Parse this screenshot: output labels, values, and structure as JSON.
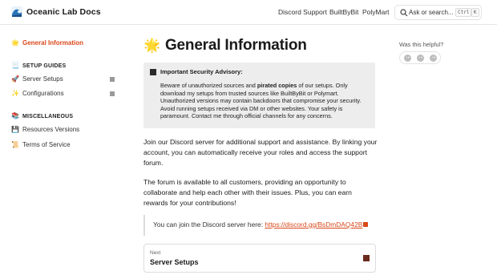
{
  "header": {
    "site_title": "Oceanic Lab Docs",
    "logo_icon": "wave-icon",
    "nav": [
      "Discord Support",
      "BuiltByBit",
      "PolyMart"
    ],
    "search_placeholder": "Ask or search...",
    "search_shortcut": [
      "Ctrl",
      "K"
    ]
  },
  "sidebar": {
    "active_item": {
      "emoji": "🌟",
      "label": "General Information"
    },
    "sections": [
      {
        "heading": {
          "emoji": "📃",
          "label": "SETUP GUIDES"
        },
        "items": [
          {
            "emoji": "🚀",
            "label": "Server Setups"
          },
          {
            "emoji": "✨",
            "label": "Configurations"
          }
        ]
      },
      {
        "heading": {
          "emoji": "📚",
          "label": "MISCELLANEOUS"
        },
        "items": [
          {
            "emoji": "💾",
            "label": "Resources Versions"
          },
          {
            "emoji": "📜",
            "label": "Terms of Service"
          }
        ]
      }
    ]
  },
  "main": {
    "title_emoji": "🌟",
    "title": "General Information",
    "advisory": {
      "title": "Important Security Advisory:",
      "body_pre": "Beware of unauthorized sources and ",
      "body_bold": "pirated copies",
      "body_post": " of our setups. Only download my setups from trusted sources like BuiltByBit or Polymart. Unauthorized versions may contain backdoors that compromise your security. Avoid running setups received via DM or other websites. Your safety is paramount. Contact me through official channels for any concerns."
    },
    "paragraph1": "Join our Discord server for additional support and assistance. By linking your account, you can automatically receive your roles and access the support forum.",
    "paragraph2": "The forum is available to all customers, providing an opportunity to collaborate and help each other with their issues. Plus, you can earn rewards for your contributions!",
    "quote_text": "You can join the Discord server here: ",
    "quote_link": "https://discord.gg/BsDmDAQ42B",
    "next": {
      "label": "Next",
      "title": "Server Setups"
    }
  },
  "feedback": {
    "question": "Was this helpful?",
    "faces": [
      "sad-face-icon",
      "neutral-face-icon",
      "happy-face-icon"
    ]
  },
  "colors": {
    "accent": "#d9481b",
    "advisory_bg": "#ededed"
  }
}
